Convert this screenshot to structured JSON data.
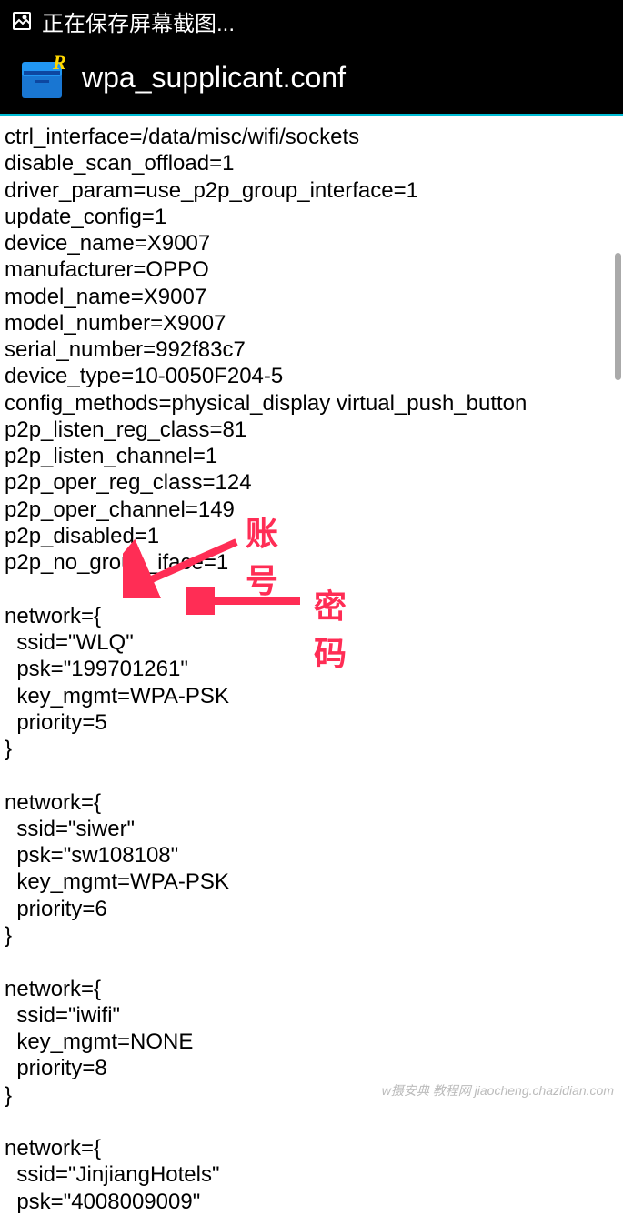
{
  "statusBar": {
    "text": "正在保存屏幕截图..."
  },
  "header": {
    "title": "wpa_supplicant.conf"
  },
  "fileContent": "ctrl_interface=/data/misc/wifi/sockets\ndisable_scan_offload=1\ndriver_param=use_p2p_group_interface=1\nupdate_config=1\ndevice_name=X9007\nmanufacturer=OPPO\nmodel_name=X9007\nmodel_number=X9007\nserial_number=992f83c7\ndevice_type=10-0050F204-5\nconfig_methods=physical_display virtual_push_button\np2p_listen_reg_class=81\np2p_listen_channel=1\np2p_oper_reg_class=124\np2p_oper_channel=149\np2p_disabled=1\np2p_no_group_iface=1\n\nnetwork={\n  ssid=\"WLQ\"\n  psk=\"199701261\"\n  key_mgmt=WPA-PSK\n  priority=5\n}\n\nnetwork={\n  ssid=\"siwer\"\n  psk=\"sw108108\"\n  key_mgmt=WPA-PSK\n  priority=6\n}\n\nnetwork={\n  ssid=\"iwifi\"\n  key_mgmt=NONE\n  priority=8\n}\n\nnetwork={\n  ssid=\"JinjiangHotels\"\n  psk=\"4008009009\"",
  "annotations": {
    "account": "账号",
    "password": "密码"
  },
  "watermark": "w摄安典  教程网 jiaocheng.chazidian.com"
}
